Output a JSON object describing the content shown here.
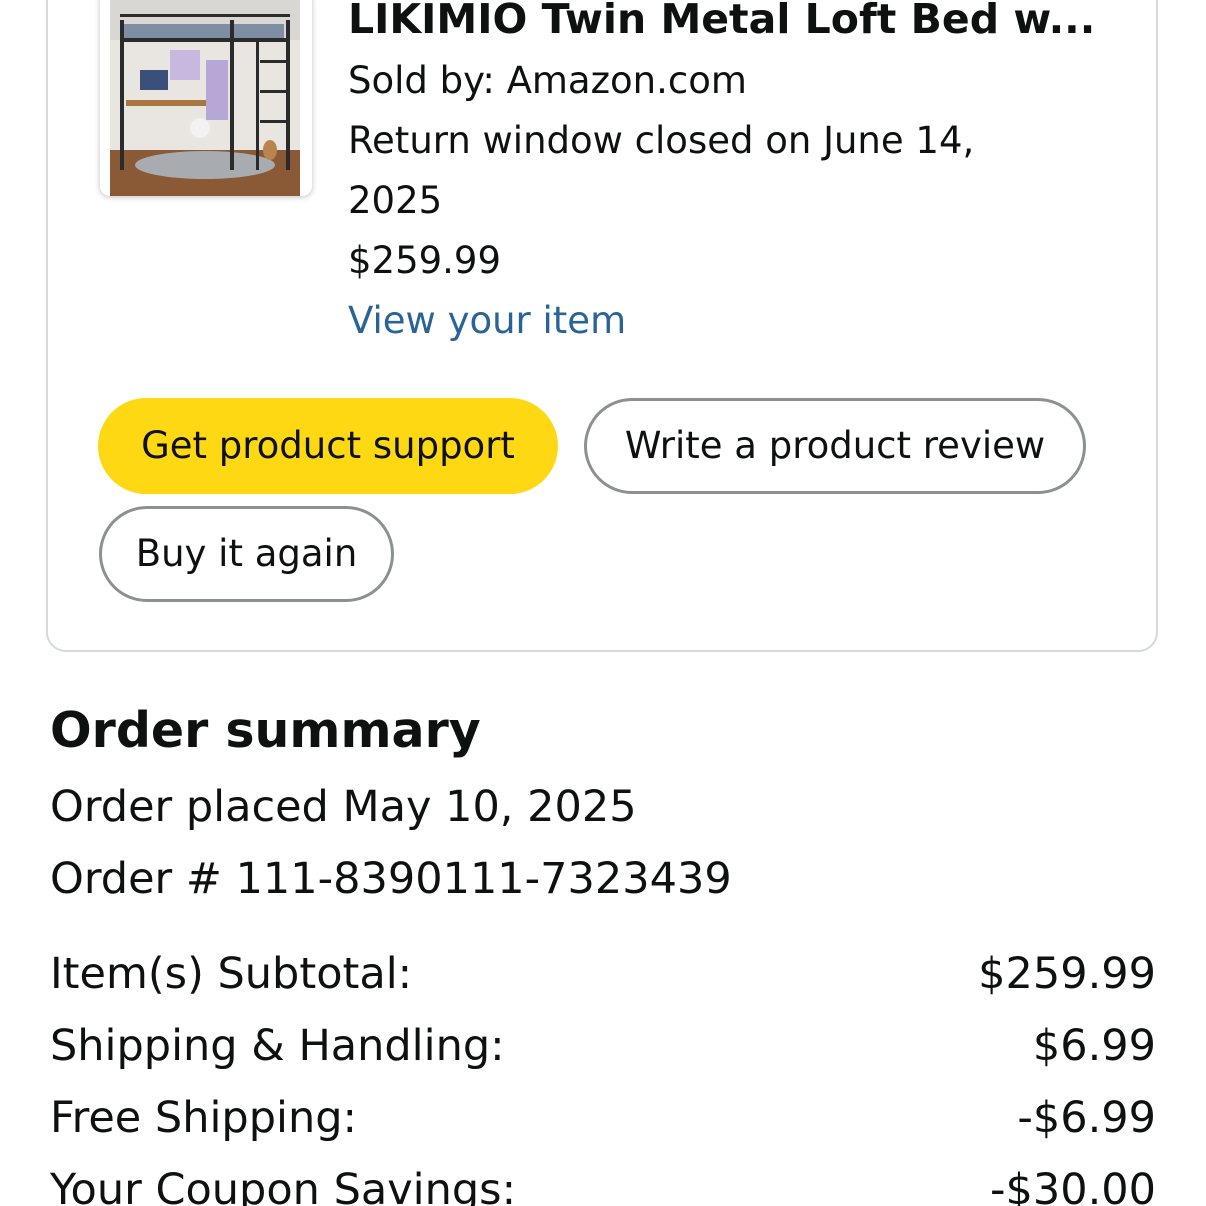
{
  "item": {
    "title": "LIKIMIO Twin Metal Loft Bed w...",
    "sold_by": "Sold by: Amazon.com",
    "return_line1": "Return window closed on June 14,",
    "return_line2": "2025",
    "price": "$259.99",
    "view_link": "View your item"
  },
  "actions": {
    "support_label": "Get product support",
    "review_label": "Write a product review",
    "buy_again_label": "Buy it again"
  },
  "summary": {
    "title": "Order summary",
    "placed": "Order placed May 10, 2025",
    "order_number": "Order # 111-8390111-7323439",
    "rows": [
      {
        "label": "Item(s) Subtotal:",
        "value": "$259.99"
      },
      {
        "label": "Shipping & Handling:",
        "value": "$6.99"
      },
      {
        "label": "Free Shipping:",
        "value": "-$6.99"
      },
      {
        "label": "Your Coupon Savings:",
        "value": "-$30.00"
      }
    ]
  },
  "colors": {
    "primary_button": "#ffd814",
    "link": "#2a6496",
    "card_border": "#d5d9d9"
  },
  "icons": {
    "product_image": "loft-bed-product-image"
  }
}
